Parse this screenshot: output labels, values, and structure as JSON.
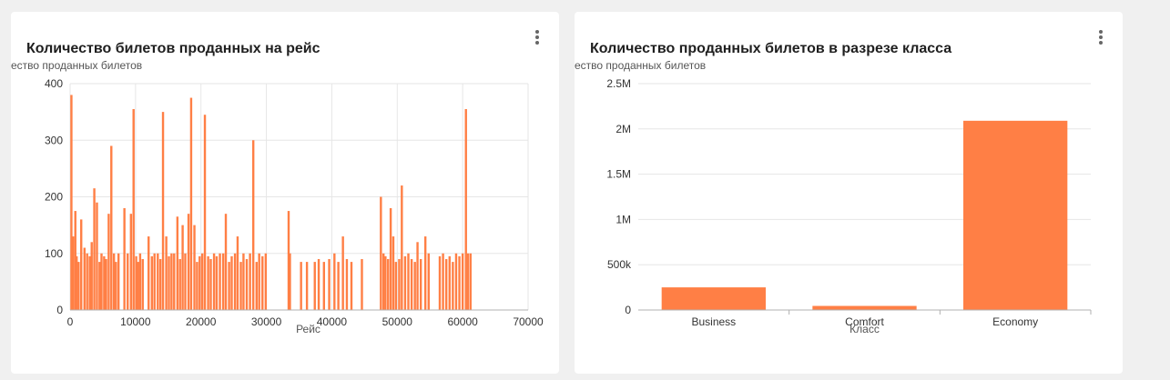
{
  "cards": [
    {
      "title": "Количество билетов проданных на рейс",
      "ylabel_visible": "ество проданных билетов"
    },
    {
      "title": "Количество проданных билетов в разрезе класса",
      "ylabel_visible": "ество проданных билетов"
    }
  ],
  "colors": {
    "bar": "#ff7f45",
    "grid": "#e6e6e6",
    "axis": "#b0b0b0",
    "card_bg": "#ffffff",
    "page_bg": "#f0f0f0"
  },
  "icons": {
    "menu": "more-vertical-icon"
  },
  "chart_data": [
    {
      "type": "bar",
      "title": "Количество билетов проданных на рейс",
      "xlabel": "Рейс",
      "ylabel": "ество проданных билетов",
      "xlim": [
        0,
        70000
      ],
      "ylim": [
        0,
        400
      ],
      "xticks": [
        0,
        10000,
        20000,
        30000,
        40000,
        50000,
        60000,
        70000
      ],
      "yticks": [
        0,
        100,
        200,
        300,
        400
      ],
      "grid": true,
      "x": [
        200,
        450,
        800,
        1000,
        1300,
        1700,
        2200,
        2600,
        3000,
        3300,
        3700,
        4100,
        4500,
        4800,
        5200,
        5500,
        5900,
        6300,
        6700,
        7000,
        7400,
        8300,
        8800,
        9300,
        9700,
        10100,
        10400,
        10700,
        11100,
        12000,
        12500,
        12900,
        13400,
        13800,
        14200,
        14700,
        15100,
        15500,
        15900,
        16400,
        16800,
        17200,
        17600,
        18100,
        18500,
        19000,
        19400,
        19800,
        20200,
        20600,
        21100,
        21500,
        22000,
        22400,
        22900,
        23400,
        23800,
        24300,
        24700,
        25200,
        25600,
        26100,
        26500,
        27000,
        27500,
        28000,
        28500,
        28900,
        29400,
        29900,
        33400,
        33600,
        35300,
        36200,
        37400,
        38000,
        38800,
        39600,
        40400,
        41000,
        41700,
        42300,
        43000,
        44600,
        47500,
        47900,
        48200,
        48600,
        49000,
        49400,
        49800,
        50300,
        50700,
        51200,
        51700,
        52200,
        52700,
        53100,
        53600,
        54300,
        54800,
        56500,
        57000,
        57500,
        58000,
        58500,
        59000,
        59500,
        60000,
        60500,
        60800,
        61200,
        61700
      ],
      "values": [
        380,
        130,
        175,
        95,
        85,
        160,
        110,
        100,
        95,
        120,
        215,
        190,
        85,
        100,
        95,
        90,
        170,
        290,
        100,
        85,
        100,
        180,
        100,
        170,
        355,
        95,
        85,
        100,
        90,
        130,
        95,
        100,
        100,
        90,
        350,
        130,
        95,
        100,
        100,
        165,
        90,
        150,
        100,
        170,
        375,
        150,
        85,
        95,
        100,
        345,
        95,
        90,
        100,
        95,
        100,
        100,
        170,
        85,
        95,
        100,
        130,
        85,
        100,
        90,
        100,
        300,
        85,
        100,
        95,
        100,
        175,
        100,
        85,
        85,
        85,
        90,
        85,
        90,
        100,
        85,
        130,
        90,
        85,
        90,
        200,
        100,
        95,
        90,
        180,
        130,
        85,
        90,
        220,
        95,
        100,
        90,
        85,
        120,
        90,
        130,
        100,
        95,
        100,
        90,
        95,
        85,
        100,
        95,
        100,
        355,
        100,
        100
      ]
    },
    {
      "type": "bar",
      "title": "Количество проданных билетов в разрезе класса",
      "xlabel": "Класс",
      "ylabel": "ество проданных билетов",
      "categories": [
        "Business",
        "Comfort",
        "Economy"
      ],
      "values": [
        250000,
        45000,
        2090000
      ],
      "ylim": [
        0,
        2500000
      ],
      "yticks": [
        0,
        500000,
        1000000,
        1500000,
        2000000,
        2500000
      ],
      "ytick_labels": [
        "0",
        "500k",
        "1M",
        "1.5M",
        "2M",
        "2.5M"
      ],
      "grid": true
    }
  ]
}
